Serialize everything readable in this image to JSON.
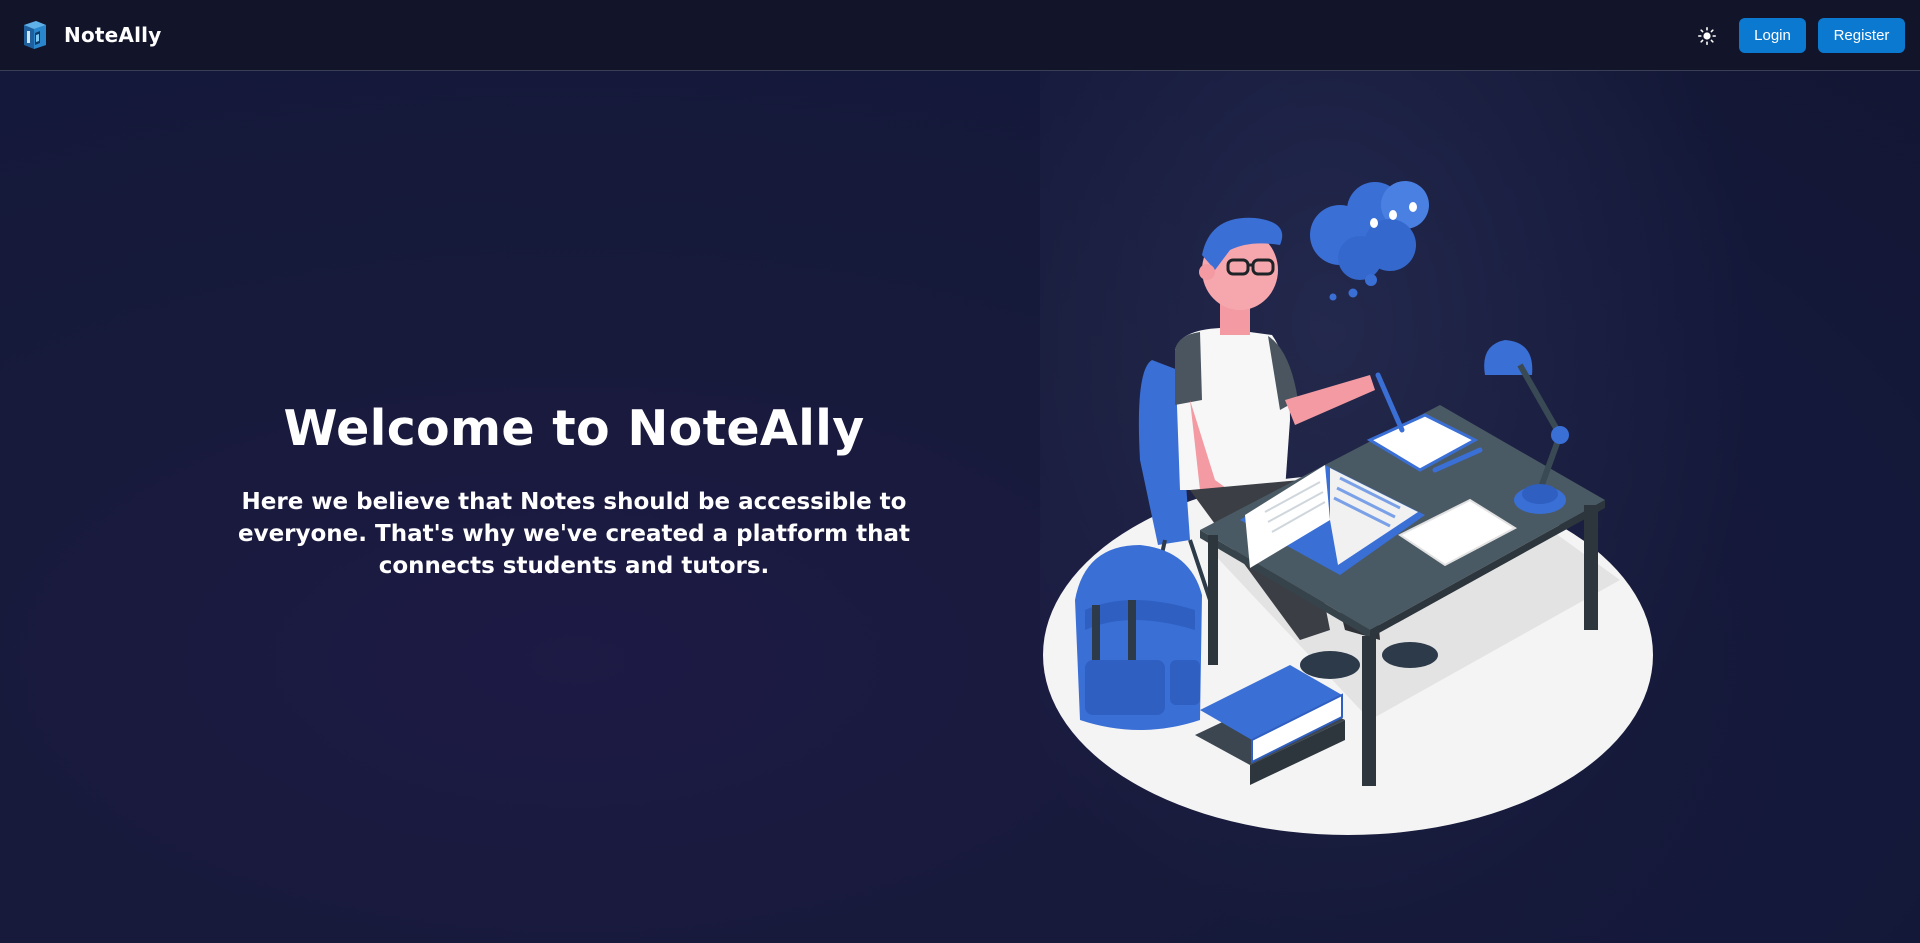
{
  "brand": {
    "name": "NoteAlly",
    "logo_icon": "book-logo-icon"
  },
  "header": {
    "theme_toggle_icon": "sun-icon",
    "login_label": "Login",
    "register_label": "Register"
  },
  "hero": {
    "title": "Welcome to NoteAlly",
    "subtitle": "Here we believe that Notes should be accessible to everyone. That's why we've created a platform that connects students and tutors."
  },
  "illustration": {
    "icon": "student-studying-illustration"
  },
  "colors": {
    "accent": "#0b79d0",
    "background": "#171a3a",
    "header_bg": "#121529",
    "illustration_blue": "#3a6fd6"
  }
}
